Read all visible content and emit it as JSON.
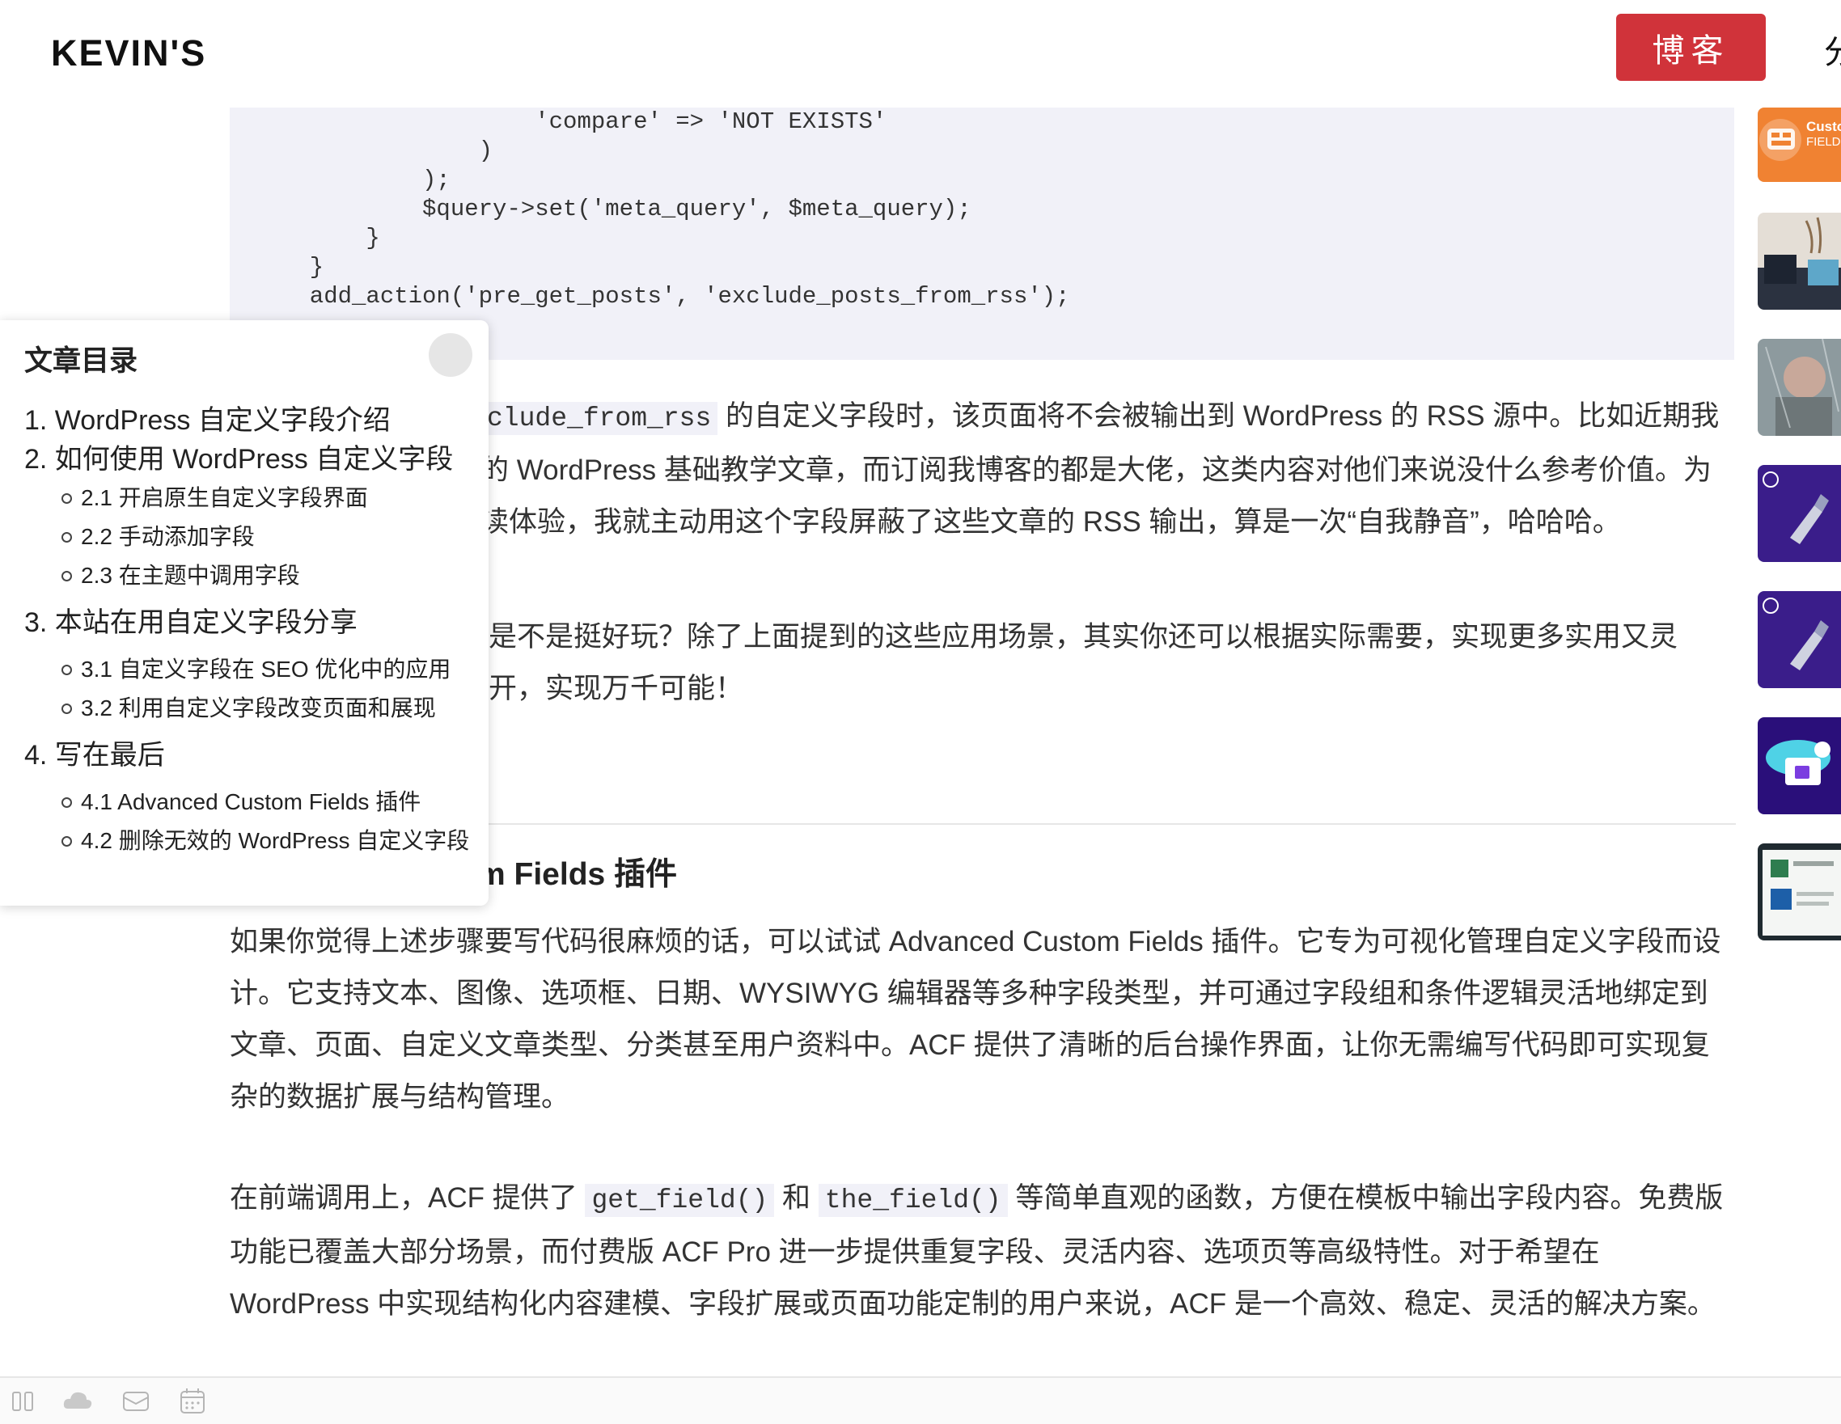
{
  "header": {
    "logo": "KEVIN'S",
    "blog_button": "博客",
    "partial_nav": "分"
  },
  "code_lines": [
    "                  'compare' => 'NOT EXISTS'",
    "              )",
    "          );",
    "          $query->set('meta_query', $meta_query);",
    "      }",
    "  }",
    "  add_action('pre_get_posts', 'exclude_posts_from_rss');"
  ],
  "article": {
    "p1": {
      "code": "clude_from_rss",
      "line1": "的自定义字段时，该页面将不会被输出到 WordPress 的 RSS 源中。比如近期我",
      "line2": "的 WordPress 基础教学文章，而订阅我博客的都是大佬，这类内容对他们来说没什么参考价值。为",
      "line3": "读体验，我就主动用这个字段屏蔽了这些文章的 RSS 输出，算是一次“自我静音”，哈哈哈。"
    },
    "p2": {
      "line1": "是不是挺好玩？除了上面提到的这些应用场景，其实你还可以根据实际需要，实现更多实用又灵",
      "line2": "开，实现万千可能！"
    },
    "section_heading": "m Fields 插件",
    "p3": "如果你觉得上述步骤要写代码很麻烦的话，可以试试 Advanced Custom Fields 插件。它专为可视化管理自定义字段而设计。它支持文本、图像、选项框、日期、WYSIWYG 编辑器等多种字段类型，并可通过字段组和条件逻辑灵活地绑定到文章、页面、自定义文章类型、分类甚至用户资料中。ACF 提供了清晰的后台操作界面，让你无需编写代码即可实现复杂的数据扩展与结构管理。",
    "p4": {
      "prefix": "在前端调用上，ACF 提供了",
      "code1": "get_field()",
      "mid": "和",
      "code2": "the_field()",
      "suffix": "等简单直观的函数，方便在模板中输出字段内容。免费版功能已覆盖大部分场景，而付费版 ACF Pro 进一步提供重复字段、灵活内容、选项页等高级特性。对于希望在 WordPress 中实现结构化内容建模、字段扩展或页面功能定制的用户来说，ACF 是一个高效、稳定、灵活的解决方案。"
    }
  },
  "toc": {
    "title": "文章目录",
    "items": [
      {
        "label": "1. WordPress 自定义字段介绍",
        "subs": []
      },
      {
        "label": "2. 如何使用 WordPress 自定义字段",
        "subs": [
          "2.1 开启原生自定义字段界面",
          "2.2 手动添加字段",
          "2.3 在主题中调用字段"
        ]
      },
      {
        "label": "3. 本站在用自定义字段分享",
        "subs": [
          "3.1 自定义字段在 SEO 优化中的应用",
          "3.2 利用自定义字段改变页面和展现"
        ]
      },
      {
        "label": "4. 写在最后",
        "subs": [
          "4.1 Advanced Custom Fields 插件",
          "4.2 删除无效的 WordPress 自定义字段"
        ]
      }
    ]
  },
  "sidebar": {
    "thumb1_label": "Custo",
    "thumb1_sub": "FIELD"
  },
  "colors": {
    "accent": "#d0333a",
    "code_bg": "#f1f1f8"
  }
}
